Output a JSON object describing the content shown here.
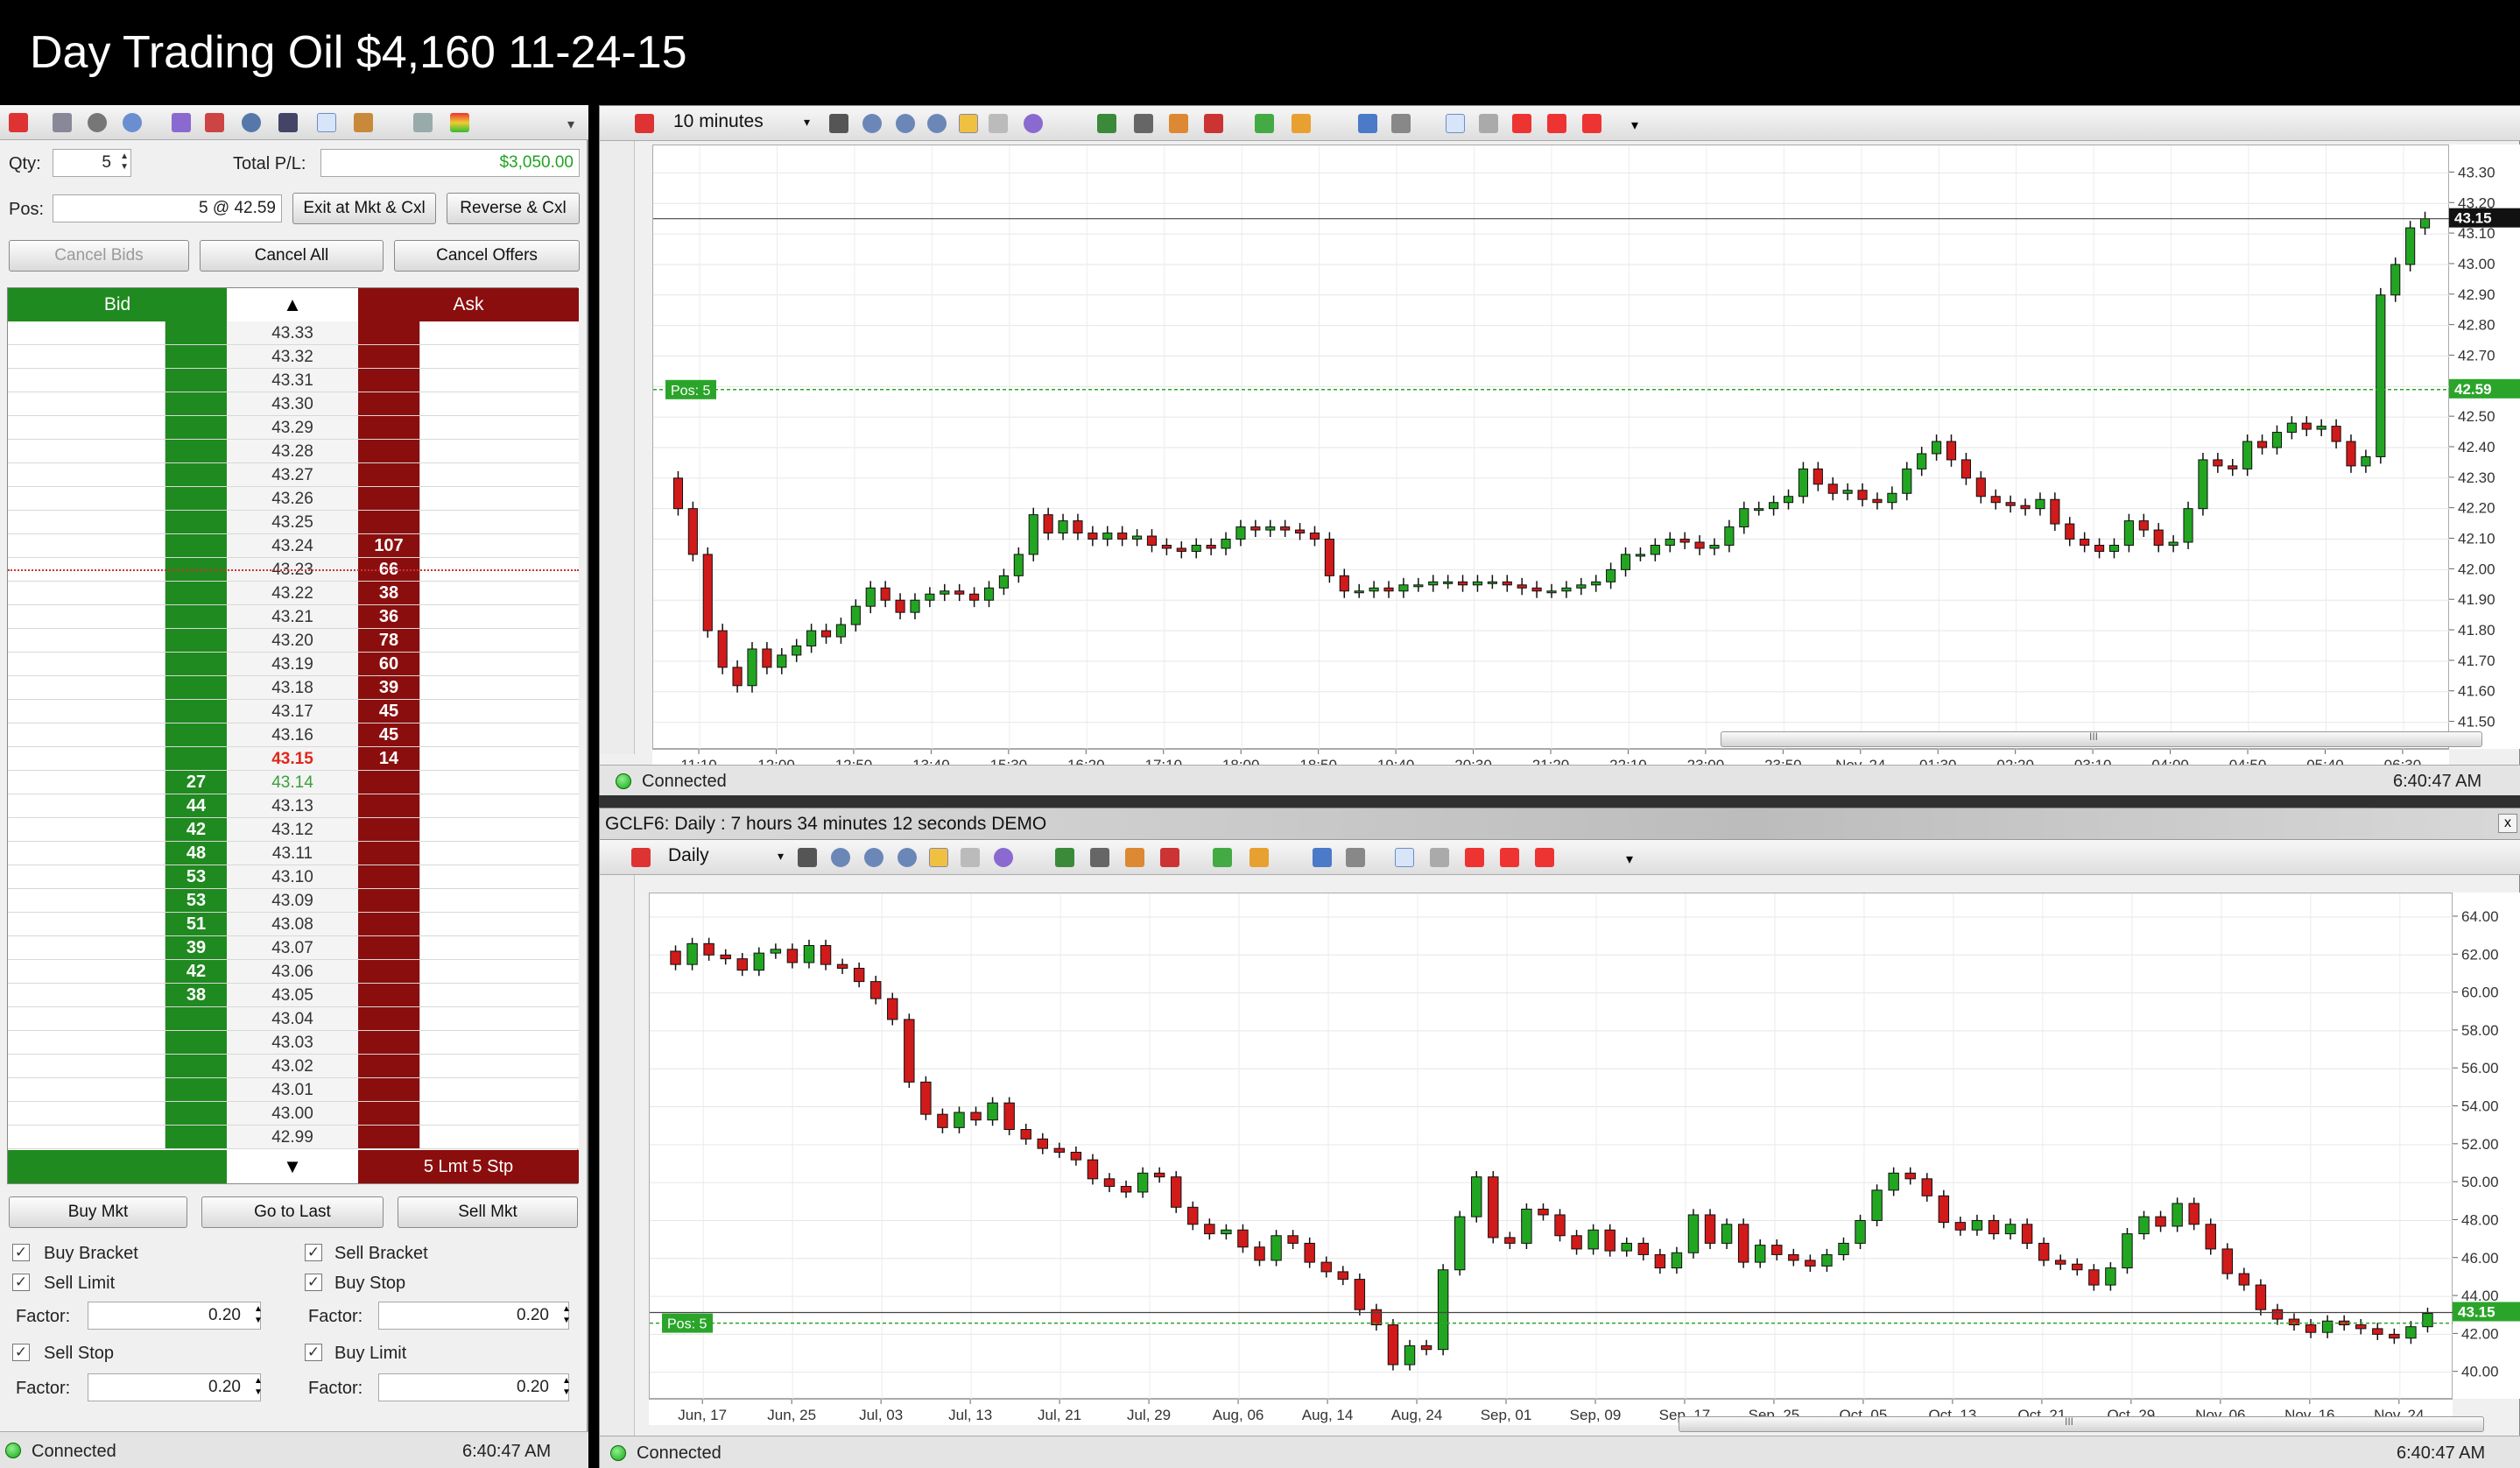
{
  "video_title": "Day Trading Oil $4,160 11-24-15",
  "colors": {
    "bid": "#1f8a1f",
    "ask": "#8b0e0e",
    "up": "#22a622",
    "down": "#d11a1a",
    "last": "#e0261b",
    "pos_line": "#2aa52a"
  },
  "dom": {
    "toolbar_icons": [
      "pin-icon",
      "calculator-icon",
      "gear-icon",
      "refresh-icon",
      "chart-icon",
      "flag-icon",
      "clock-icon",
      "shield-icon",
      "draw-icon",
      "tools-icon",
      "window-icon",
      "color-icon"
    ],
    "qty_label": "Qty:",
    "qty_value": "5",
    "total_pl_label": "Total P/L:",
    "total_pl_value": "$3,050.00",
    "pos_label": "Pos:",
    "pos_value": "5 @ 42.59",
    "exit_button": "Exit at Mkt & Cxl",
    "reverse_button": "Reverse & Cxl",
    "cancel_bids": "Cancel Bids",
    "cancel_all": "Cancel All",
    "cancel_offers": "Cancel Offers",
    "bid_header": "Bid",
    "ask_header": "Ask",
    "last_price": "43.15",
    "mid_price": "43.14",
    "ask_footer": "5 Lmt 5 Stp",
    "rows": [
      {
        "price": "43.33",
        "bid": "",
        "ask": ""
      },
      {
        "price": "43.32",
        "bid": "",
        "ask": ""
      },
      {
        "price": "43.31",
        "bid": "",
        "ask": ""
      },
      {
        "price": "43.30",
        "bid": "",
        "ask": ""
      },
      {
        "price": "43.29",
        "bid": "",
        "ask": ""
      },
      {
        "price": "43.28",
        "bid": "",
        "ask": ""
      },
      {
        "price": "43.27",
        "bid": "",
        "ask": ""
      },
      {
        "price": "43.26",
        "bid": "",
        "ask": ""
      },
      {
        "price": "43.25",
        "bid": "",
        "ask": ""
      },
      {
        "price": "43.24",
        "bid": "",
        "ask": "107"
      },
      {
        "price": "43.23",
        "bid": "",
        "ask": "66"
      },
      {
        "price": "43.22",
        "bid": "",
        "ask": "38"
      },
      {
        "price": "43.21",
        "bid": "",
        "ask": "36"
      },
      {
        "price": "43.20",
        "bid": "",
        "ask": "78"
      },
      {
        "price": "43.19",
        "bid": "",
        "ask": "60"
      },
      {
        "price": "43.18",
        "bid": "",
        "ask": "39"
      },
      {
        "price": "43.17",
        "bid": "",
        "ask": "45"
      },
      {
        "price": "43.16",
        "bid": "",
        "ask": "45"
      },
      {
        "price": "43.15",
        "bid": "",
        "ask": "14"
      },
      {
        "price": "43.14",
        "bid": "27",
        "ask": ""
      },
      {
        "price": "43.13",
        "bid": "44",
        "ask": ""
      },
      {
        "price": "43.12",
        "bid": "42",
        "ask": ""
      },
      {
        "price": "43.11",
        "bid": "48",
        "ask": ""
      },
      {
        "price": "43.10",
        "bid": "53",
        "ask": ""
      },
      {
        "price": "43.09",
        "bid": "53",
        "ask": ""
      },
      {
        "price": "43.08",
        "bid": "51",
        "ask": ""
      },
      {
        "price": "43.07",
        "bid": "39",
        "ask": ""
      },
      {
        "price": "43.06",
        "bid": "42",
        "ask": ""
      },
      {
        "price": "43.05",
        "bid": "38",
        "ask": ""
      },
      {
        "price": "43.04",
        "bid": "",
        "ask": ""
      },
      {
        "price": "43.03",
        "bid": "",
        "ask": ""
      },
      {
        "price": "43.02",
        "bid": "",
        "ask": ""
      },
      {
        "price": "43.01",
        "bid": "",
        "ask": ""
      },
      {
        "price": "43.00",
        "bid": "",
        "ask": ""
      },
      {
        "price": "42.99",
        "bid": "",
        "ask": ""
      }
    ],
    "buy_mkt": "Buy Mkt",
    "go_to_last": "Go to Last",
    "sell_mkt": "Sell Mkt",
    "buy_bracket": "Buy Bracket",
    "sell_bracket": "Sell Bracket",
    "sell_limit": "Sell Limit",
    "buy_stop": "Buy Stop",
    "factor_label": "Factor:",
    "factor_values": [
      "0.20",
      "0.20",
      "0.20",
      "0.20"
    ],
    "sell_stop": "Sell Stop",
    "buy_limit": "Buy Limit",
    "status": "Connected",
    "time": "6:40:47 AM"
  },
  "chart_top": {
    "interval": "10 minutes",
    "pos_label": "Pos: 5",
    "status": "Connected",
    "time": "6:40:47 AM",
    "price_badge": "43.15",
    "pos_badge": "42.59",
    "scrollbar_grip": "III"
  },
  "chart_bottom": {
    "window_title": "GCLF6: Daily : 7 hours 34 minutes 12 seconds DEMO",
    "interval": "Daily",
    "pos_label": "Pos: 5",
    "status": "Connected",
    "time": "6:40:47 AM",
    "price_badge": "43.15",
    "scrollbar_grip": "III",
    "close_icon": "x"
  },
  "chart_data": [
    {
      "type": "candlestick",
      "title": "10 minutes",
      "xlabel": "",
      "ylabel": "",
      "ylim": [
        41.45,
        43.35
      ],
      "y_ticks": [
        "43.30",
        "43.20",
        "43.10",
        "43.00",
        "42.90",
        "42.80",
        "42.70",
        "42.60",
        "42.50",
        "42.40",
        "42.30",
        "42.20",
        "42.10",
        "42.00",
        "41.90",
        "41.80",
        "41.70",
        "41.60",
        "41.50"
      ],
      "x_ticks": [
        "11:10",
        "12:00",
        "12:50",
        "13:40",
        "15:30",
        "16:20",
        "17:10",
        "18:00",
        "18:50",
        "19:40",
        "20:30",
        "21:20",
        "22:10",
        "23:00",
        "23:50",
        "Nov, 24",
        "01:30",
        "02:20",
        "03:10",
        "04:00",
        "04:50",
        "05:40",
        "06:30"
      ],
      "position_line": 42.59,
      "last_line": 43.15,
      "close": [
        42.2,
        42.05,
        41.8,
        41.68,
        41.62,
        41.74,
        41.68,
        41.72,
        41.75,
        41.8,
        41.78,
        41.82,
        41.88,
        41.94,
        41.9,
        41.86,
        41.9,
        41.92,
        41.93,
        41.92,
        41.9,
        41.94,
        41.98,
        42.05,
        42.18,
        42.12,
        42.16,
        42.12,
        42.1,
        42.12,
        42.1,
        42.11,
        42.08,
        42.07,
        42.06,
        42.08,
        42.07,
        42.1,
        42.14,
        42.13,
        42.14,
        42.13,
        42.12,
        42.1,
        41.98,
        41.93,
        41.93,
        41.94,
        41.93,
        41.95,
        41.95,
        41.96,
        41.96,
        41.95,
        41.96,
        41.96,
        41.95,
        41.94,
        41.93,
        41.93,
        41.94,
        41.95,
        41.96,
        42.0,
        42.05,
        42.05,
        42.08,
        42.1,
        42.09,
        42.07,
        42.08,
        42.14,
        42.2,
        42.2,
        42.22,
        42.24,
        42.33,
        42.28,
        42.25,
        42.26,
        42.23,
        42.22,
        42.25,
        42.33,
        42.38,
        42.42,
        42.36,
        42.3,
        42.24,
        42.22,
        42.21,
        42.2,
        42.23,
        42.15,
        42.1,
        42.08,
        42.06,
        42.08,
        42.16,
        42.13,
        42.08,
        42.09,
        42.2,
        42.36,
        42.34,
        42.33,
        42.42,
        42.4,
        42.45,
        42.48,
        42.46,
        42.47,
        42.42,
        42.34,
        42.37,
        42.9,
        43.0,
        43.12,
        43.15
      ],
      "open": [
        42.3,
        42.2,
        42.05,
        41.8,
        41.68,
        41.62,
        41.74,
        41.68,
        41.72,
        41.75,
        41.8,
        41.78,
        41.82,
        41.88,
        41.94,
        41.9,
        41.86,
        41.9,
        41.92,
        41.93,
        41.92,
        41.9,
        41.94,
        41.98,
        42.05,
        42.18,
        42.12,
        42.16,
        42.12,
        42.1,
        42.12,
        42.1,
        42.11,
        42.08,
        42.07,
        42.06,
        42.08,
        42.07,
        42.1,
        42.14,
        42.13,
        42.14,
        42.13,
        42.12,
        42.1,
        41.98,
        41.93,
        41.93,
        41.94,
        41.93,
        41.95,
        41.95,
        41.96,
        41.96,
        41.95,
        41.96,
        41.96,
        41.95,
        41.94,
        41.93,
        41.93,
        41.94,
        41.95,
        41.96,
        42.0,
        42.05,
        42.05,
        42.08,
        42.1,
        42.09,
        42.07,
        42.08,
        42.14,
        42.2,
        42.2,
        42.22,
        42.24,
        42.33,
        42.28,
        42.25,
        42.26,
        42.23,
        42.22,
        42.25,
        42.33,
        42.38,
        42.42,
        42.36,
        42.3,
        42.24,
        42.22,
        42.21,
        42.2,
        42.23,
        42.15,
        42.1,
        42.08,
        42.06,
        42.08,
        42.16,
        42.13,
        42.08,
        42.09,
        42.2,
        42.36,
        42.34,
        42.33,
        42.42,
        42.4,
        42.45,
        42.48,
        42.46,
        42.47,
        42.42,
        42.34,
        42.37,
        42.9,
        43.0,
        43.12
      ]
    },
    {
      "type": "candlestick",
      "title": "Daily",
      "xlabel": "",
      "ylabel": "",
      "ylim": [
        39.2,
        64.6
      ],
      "y_ticks": [
        "64.00",
        "62.00",
        "60.00",
        "58.00",
        "56.00",
        "54.00",
        "52.00",
        "50.00",
        "48.00",
        "46.00",
        "44.00",
        "42.00",
        "40.00"
      ],
      "x_ticks": [
        "Jun, 17",
        "Jun, 25",
        "Jul, 03",
        "Jul, 13",
        "Jul, 21",
        "Jul, 29",
        "Aug, 06",
        "Aug, 14",
        "Aug, 24",
        "Sep, 01",
        "Sep, 09",
        "Sep, 17",
        "Sep, 25",
        "Oct, 05",
        "Oct, 13",
        "Oct, 21",
        "Oct, 29",
        "Nov, 06",
        "Nov, 16",
        "Nov, 24"
      ],
      "position_line": 42.59,
      "last_line": 43.15,
      "close": [
        61.5,
        62.6,
        62.0,
        61.8,
        61.2,
        62.1,
        62.3,
        61.6,
        62.5,
        61.5,
        61.3,
        60.6,
        59.7,
        58.6,
        55.3,
        53.6,
        52.9,
        53.7,
        53.3,
        54.2,
        52.8,
        52.3,
        51.8,
        51.6,
        51.2,
        50.2,
        49.8,
        49.5,
        50.5,
        50.3,
        48.7,
        47.8,
        47.3,
        47.5,
        46.6,
        45.9,
        47.2,
        46.8,
        45.8,
        45.3,
        44.9,
        43.3,
        42.5,
        40.4,
        41.4,
        41.2,
        45.4,
        48.2,
        50.3,
        47.1,
        46.8,
        48.6,
        48.3,
        47.2,
        46.5,
        47.5,
        46.4,
        46.8,
        46.2,
        45.5,
        46.3,
        48.3,
        46.8,
        47.8,
        45.8,
        46.7,
        46.2,
        45.9,
        45.6,
        46.2,
        46.8,
        48.0,
        49.6,
        50.5,
        50.2,
        49.3,
        47.9,
        47.5,
        48.0,
        47.3,
        47.8,
        46.8,
        45.9,
        45.7,
        45.4,
        44.6,
        45.5,
        47.3,
        48.2,
        47.7,
        48.9,
        47.8,
        46.5,
        45.2,
        44.6,
        43.3,
        42.8,
        42.5,
        42.1,
        42.7,
        42.5,
        42.3,
        42.0,
        41.8,
        42.4,
        43.1
      ],
      "open": [
        62.2,
        61.5,
        62.6,
        62.0,
        61.8,
        61.2,
        62.1,
        62.3,
        61.6,
        62.5,
        61.5,
        61.3,
        60.6,
        59.7,
        58.6,
        55.3,
        53.6,
        52.9,
        53.7,
        53.3,
        54.2,
        52.8,
        52.3,
        51.8,
        51.6,
        51.2,
        50.2,
        49.8,
        49.5,
        50.5,
        50.3,
        48.7,
        47.8,
        47.3,
        47.5,
        46.6,
        45.9,
        47.2,
        46.8,
        45.8,
        45.3,
        44.9,
        43.3,
        42.5,
        40.4,
        41.4,
        41.2,
        45.4,
        48.2,
        50.3,
        47.1,
        46.8,
        48.6,
        48.3,
        47.2,
        46.5,
        47.5,
        46.4,
        46.8,
        46.2,
        45.5,
        46.3,
        48.3,
        46.8,
        47.8,
        45.8,
        46.7,
        46.2,
        45.9,
        45.6,
        46.2,
        46.8,
        48.0,
        49.6,
        50.5,
        50.2,
        49.3,
        47.9,
        47.5,
        48.0,
        47.3,
        47.8,
        46.8,
        45.9,
        45.7,
        45.4,
        44.6,
        45.5,
        47.3,
        48.2,
        47.7,
        48.9,
        47.8,
        46.5,
        45.2,
        44.6,
        43.3,
        42.8,
        42.5,
        42.1,
        42.7,
        42.5,
        42.3,
        42.0,
        41.8,
        42.4
      ]
    }
  ]
}
